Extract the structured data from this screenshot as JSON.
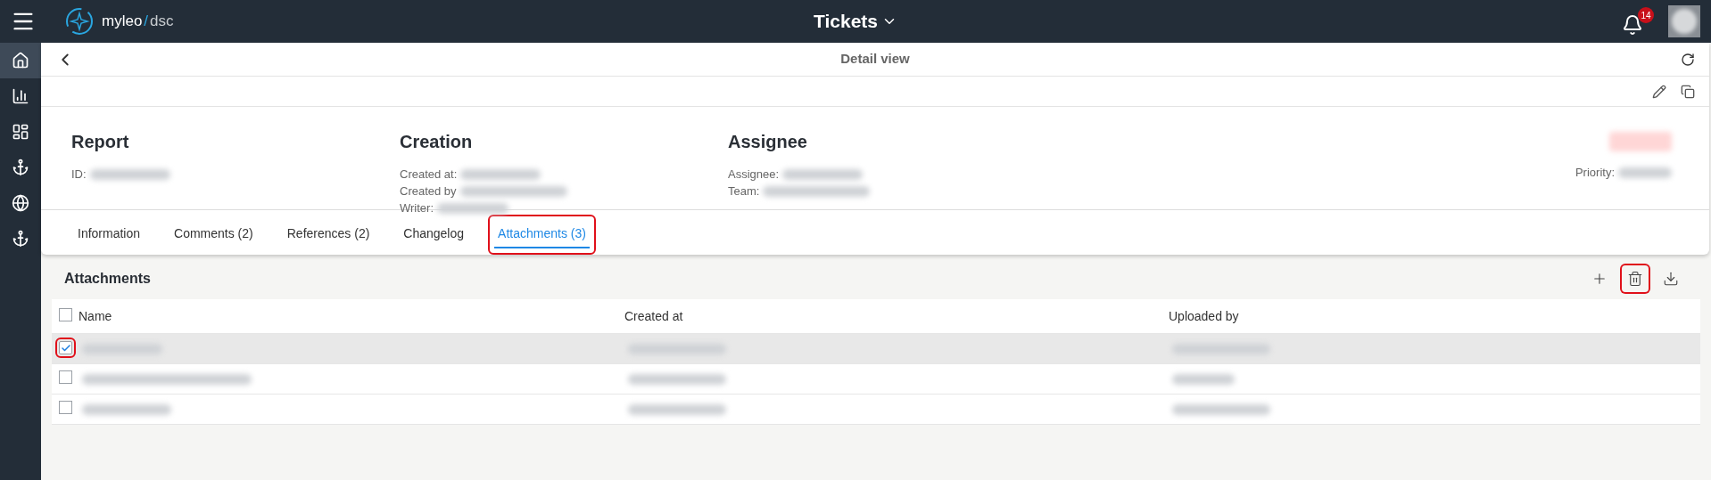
{
  "app": {
    "logo_name": "myleo",
    "logo_separator": "/",
    "logo_suffix": "dsc",
    "title": "Tickets",
    "notifications": "14"
  },
  "sidebar": {
    "items": [
      {
        "kind": "home",
        "selected": true
      },
      {
        "kind": "chart",
        "selected": false
      },
      {
        "kind": "dashboard",
        "selected": false
      },
      {
        "kind": "anchor",
        "selected": false
      },
      {
        "kind": "globe",
        "selected": false
      },
      {
        "kind": "anchor",
        "selected": false
      }
    ]
  },
  "header": {
    "title": "Detail view"
  },
  "sections": [
    {
      "title": "Report",
      "fields": [
        "ID:"
      ]
    },
    {
      "title": "Creation",
      "fields": [
        "Created at:",
        "Created by",
        "Writer:"
      ]
    },
    {
      "title": "Assignee",
      "fields": [
        "Assignee:",
        "Team:"
      ]
    }
  ],
  "priority": {
    "label": "Priority:"
  },
  "tabs": [
    {
      "label": "Information",
      "selected": false,
      "highlighted": false
    },
    {
      "label": "Comments (2)",
      "selected": false,
      "highlighted": false
    },
    {
      "label": "References (2)",
      "selected": false,
      "highlighted": false
    },
    {
      "label": "Changelog",
      "selected": false,
      "highlighted": false
    },
    {
      "label": "Attachments (3)",
      "selected": true,
      "highlighted": true
    }
  ],
  "attachments": {
    "title": "Attachments",
    "actions": [
      {
        "kind": "add",
        "highlighted": false
      },
      {
        "kind": "delete",
        "highlighted": true
      },
      {
        "kind": "download",
        "highlighted": false
      }
    ],
    "table": {
      "columns": [
        "Name",
        "Created at",
        "Uploaded by"
      ],
      "all_checked": false,
      "rows": [
        {
          "checked": true,
          "highlighted": true
        },
        {
          "checked": false,
          "highlighted": false
        },
        {
          "checked": false,
          "highlighted": false
        }
      ]
    }
  }
}
